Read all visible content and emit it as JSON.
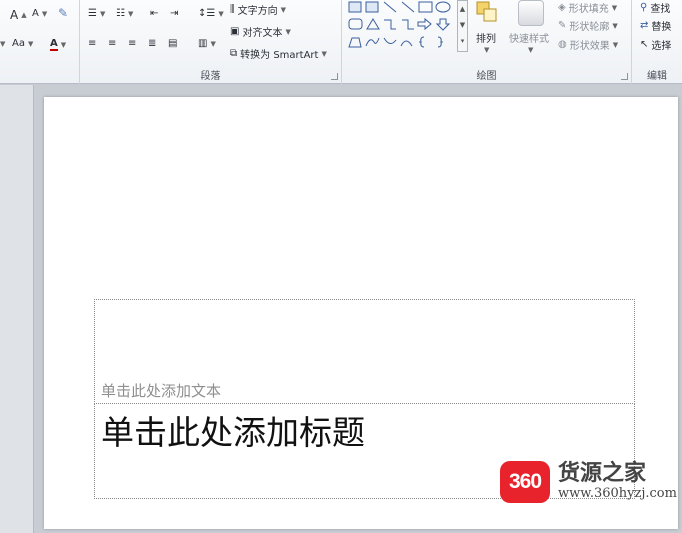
{
  "ribbon": {
    "paragraph_group_label": "段落",
    "drawing_group_label": "绘图",
    "editing_group_label": "编辑",
    "text_direction_label": "文字方向",
    "align_text_label": "对齐文本",
    "convert_smartart_label": "转换为 SmartArt",
    "arrange_label": "排列",
    "quick_styles_label": "快速样式",
    "shape_fill_label": "形状填充",
    "shape_outline_label": "形状轮廓",
    "shape_effects_label": "形状效果",
    "find_label": "查找",
    "replace_label": "替换",
    "select_label": "选择",
    "font_grow_label": "A",
    "font_shrink_label": "A",
    "change_case_label": "Aa",
    "font_color_label": "A"
  },
  "slide": {
    "subtitle_placeholder": "单击此处添加文本",
    "title_placeholder": "单击此处添加标题"
  },
  "watermark": {
    "badge": "360",
    "title": "货源之家",
    "url": "www.360hyzj.com"
  }
}
